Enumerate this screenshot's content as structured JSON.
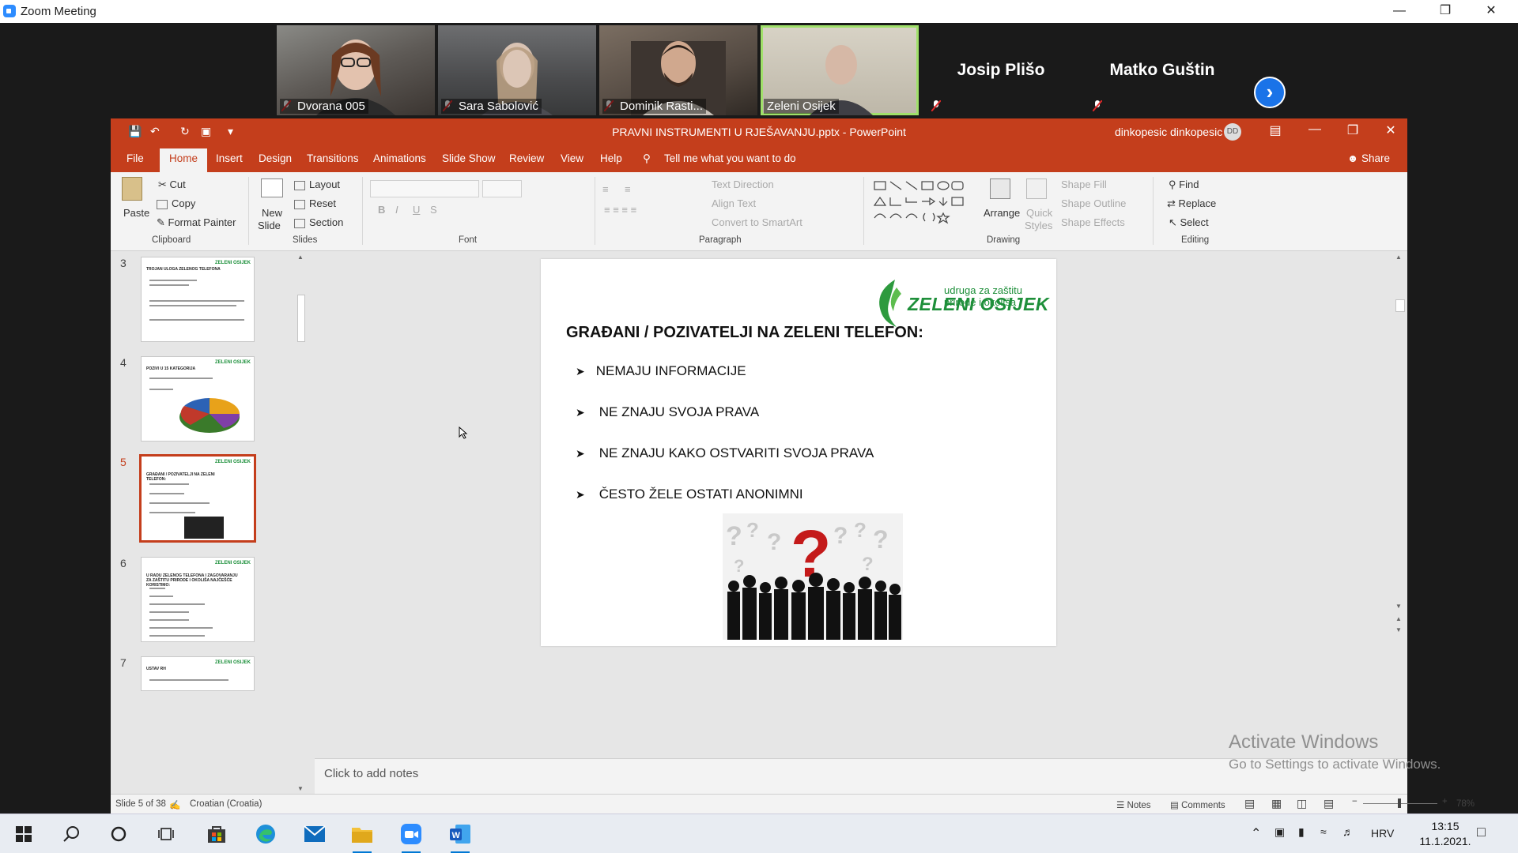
{
  "zoom": {
    "title": "Zoom Meeting",
    "participants": [
      {
        "name": "Dvorana 005"
      },
      {
        "name": "Sara Sabolović"
      },
      {
        "name": "Dominik Rasti..."
      },
      {
        "name": "Zeleni Osijek"
      },
      {
        "name": "Josip Plišo"
      },
      {
        "name": "Matko Guštin"
      }
    ]
  },
  "ppt": {
    "title": "PRAVNI INSTRUMENTI U RJEŠAVANJU.pptx  -  PowerPoint",
    "user": "dinkopesic dinkopesic",
    "user_initials": "DD",
    "tabs": [
      "File",
      "Home",
      "Insert",
      "Design",
      "Transitions",
      "Animations",
      "Slide Show",
      "Review",
      "View",
      "Help"
    ],
    "tell_me": "Tell me what you want to do",
    "share": "Share",
    "ribbon": {
      "paste": "Paste",
      "cut": "Cut",
      "copy": "Copy",
      "format_painter": "Format Painter",
      "clipboard": "Clipboard",
      "new_slide": "New",
      "new_slide_2": "Slide",
      "layout": "Layout",
      "reset": "Reset",
      "section": "Section",
      "slides": "Slides",
      "font": "Font",
      "text_direction": "Text Direction",
      "align_text": "Align Text",
      "convert_smartart": "Convert to SmartArt",
      "paragraph": "Paragraph",
      "arrange": "Arrange",
      "quick_styles": "Quick",
      "quick_styles_2": "Styles",
      "shape_fill": "Shape Fill",
      "shape_outline": "Shape Outline",
      "shape_effects": "Shape Effects",
      "drawing": "Drawing",
      "find": "Find",
      "replace": "Replace",
      "select": "Select",
      "editing": "Editing"
    },
    "thumbs": [
      {
        "num": "3",
        "title": "TROJAN ULOGA ZELENOG TELEFONA"
      },
      {
        "num": "4",
        "title": "POZIVI U 15 KATEGORIJA"
      },
      {
        "num": "5",
        "title": "GRAĐANI / POZIVATELJI NA ZELENI TELEFON:"
      },
      {
        "num": "6",
        "title": "U RADU ZELENOG TELEFONA I ZAGOVARANJU ZA ZAŠTITU PRIRODE I OKOLIŠA NAJČEŠĆE KORISTIMO:"
      },
      {
        "num": "7",
        "title": "USTAV RH"
      }
    ],
    "thumb_logo": "ZELENI OSIJEK",
    "slide": {
      "logo_tag": "udruga za zaštitu prirode i okoliša",
      "logo_name": "ZELENI OSIJEK",
      "title": "GRAĐANI / POZIVATELJI NA ZELENI TELEFON:",
      "bullets": [
        "NEMAJU INFORMACIJE",
        "NE ZNAJU SVOJA PRAVA",
        "NE ZNAJU KAKO OSTVARITI SVOJA PRAVA",
        "ČESTO ŽELE OSTATI ANONIMNI"
      ]
    },
    "notes_placeholder": "Click to add notes",
    "status": {
      "slide": "Slide 5 of 38",
      "language": "Croatian (Croatia)",
      "notes": "Notes",
      "comments": "Comments",
      "zoom": "78%"
    }
  },
  "watermark": {
    "line1": "Activate Windows",
    "line2": "Go to Settings to activate Windows."
  },
  "taskbar": {
    "language": "HRV",
    "time": "13:15",
    "date": "11.1.2021."
  }
}
